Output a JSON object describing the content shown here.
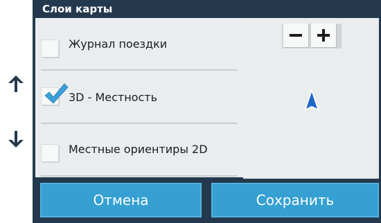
{
  "title": "Слои карты",
  "layers": [
    {
      "label": "Журнал поездки",
      "checked": false
    },
    {
      "label": "3D - Местность",
      "checked": true
    },
    {
      "label": "Местные ориентиры 2D",
      "checked": false
    }
  ],
  "map": {
    "zoom_out_icon": "minus-icon",
    "zoom_in_icon": "plus-icon",
    "pointer_icon": "navigation-arrow-icon"
  },
  "buttons": {
    "cancel": "Отмена",
    "save": "Сохранить"
  },
  "colors": {
    "frame": "#24394e",
    "button": "#35a0d1",
    "check": "#3aa0d8",
    "pointer": "#1f66c9"
  }
}
